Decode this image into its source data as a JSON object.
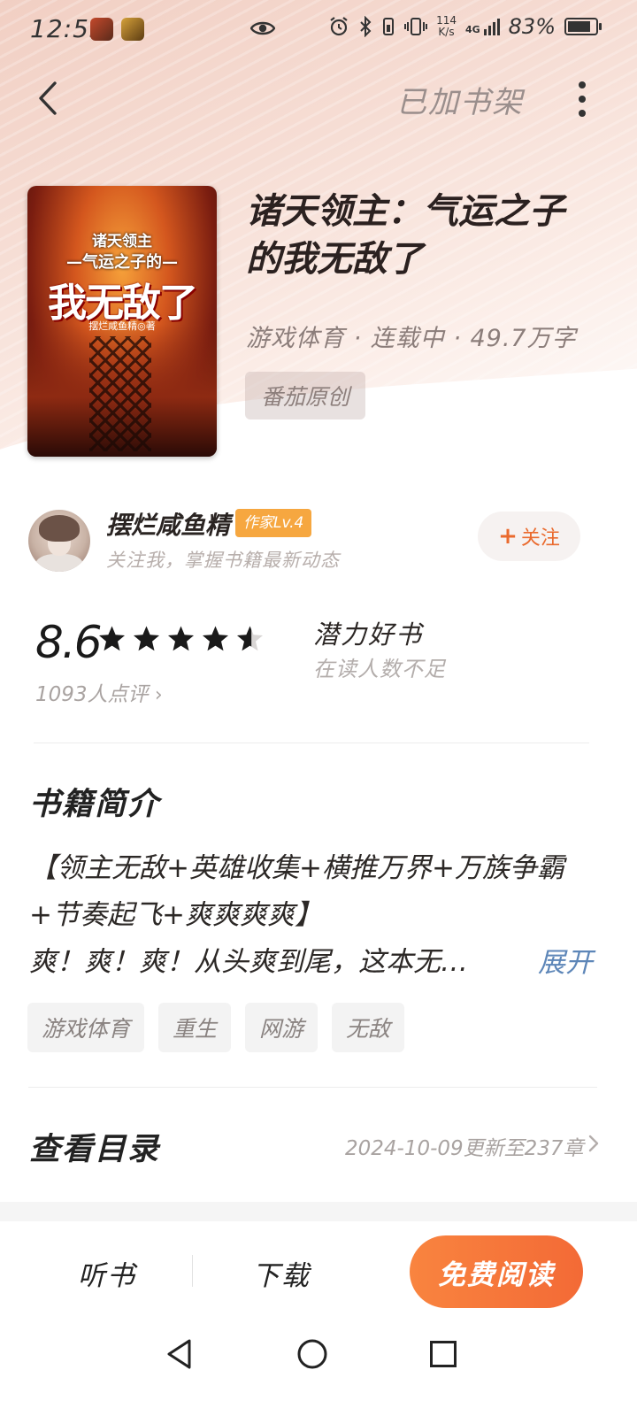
{
  "status_bar": {
    "time": "12:55",
    "net_speed_value": "114",
    "net_speed_unit": "K/s",
    "network": "4G",
    "battery": "83%",
    "battery_level": 0.83
  },
  "nav": {
    "back_icon": "chevron-left-icon",
    "shelf_label": "已加书架",
    "more_icon": "more-vertical-icon"
  },
  "book": {
    "cover": {
      "line1": "诸天领主",
      "line2": "—气运之子的—",
      "line3": "我无敌了",
      "author_line": "摆烂咸鱼精◎著"
    },
    "title": "诸天领主：气运之子的我无敌了",
    "meta": "游戏体育 · 连载中 · 49.7万字",
    "origin_badge": "番茄原创"
  },
  "author": {
    "name": "摆烂咸鱼精",
    "level": "作家Lv.4",
    "subtitle": "关注我，掌握书籍最新动态",
    "follow_label": "关注",
    "follow_icon": "plus-icon"
  },
  "rating": {
    "score": "8.6",
    "stars_value": 4.3,
    "stars_max": 5,
    "review_count": "1093人点评",
    "potential_title": "潜力好书",
    "potential_sub": "在读人数不足"
  },
  "intro": {
    "title": "书籍简介",
    "lines": [
      "【领主无敌+英雄收集+横推万界+万族争霸",
      "+节奏起飞+爽爽爽爽】",
      "爽！爽！爽！从头爽到尾，这本无…"
    ],
    "expand_label": "展开"
  },
  "tags": [
    "游戏体育",
    "重生",
    "网游",
    "无敌"
  ],
  "catalog": {
    "title": "查看目录",
    "update": "2024-10-09更新至237章"
  },
  "actions": {
    "listen": "听书",
    "download": "下载",
    "read": "免费阅读"
  },
  "colors": {
    "accent_orange": "#F36A36",
    "level_badge": "#F6A740",
    "expand_link": "#5D86B8"
  }
}
